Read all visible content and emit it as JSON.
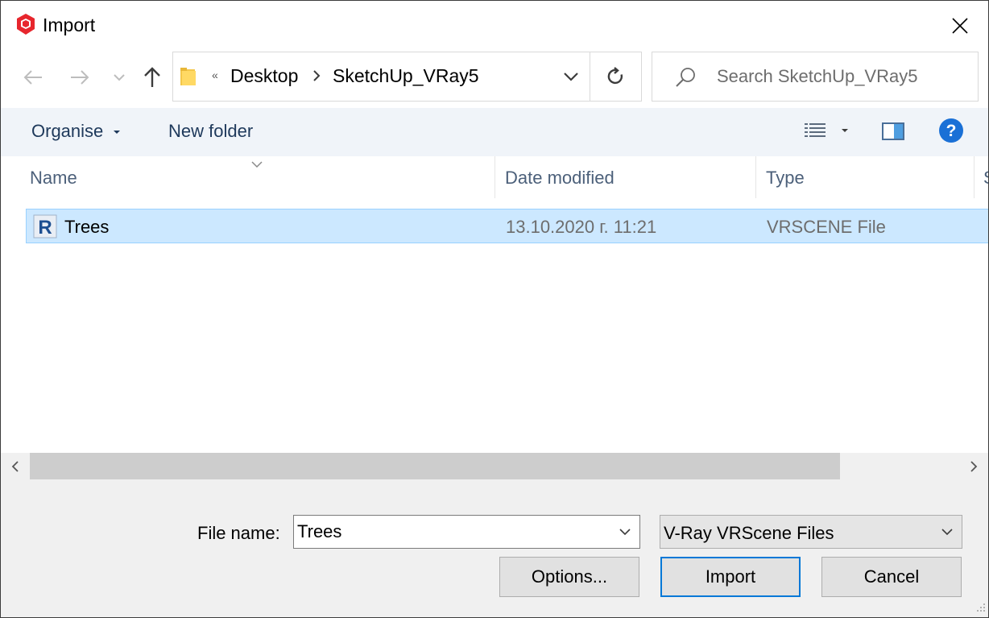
{
  "window": {
    "title": "Import",
    "app_icon": "sketchup-logo-icon"
  },
  "nav": {
    "back_icon": "back-arrow-icon",
    "forward_icon": "forward-arrow-icon",
    "recent_icon": "chevron-down-icon",
    "up_icon": "up-arrow-icon"
  },
  "address": {
    "overflow": "«",
    "crumbs": [
      "Desktop",
      "SketchUp_VRay5"
    ]
  },
  "search": {
    "placeholder": "Search SketchUp_VRay5"
  },
  "toolbar": {
    "organise": "Organise",
    "new_folder": "New folder"
  },
  "columns": {
    "name": "Name",
    "date": "Date modified",
    "type": "Type",
    "size_partial": "S"
  },
  "files": [
    {
      "name": "Trees",
      "date": "13.10.2020 г. 11:21",
      "type": "VRSCENE File",
      "icon": "vrscene-file-icon"
    }
  ],
  "bottom": {
    "file_name_label": "File name:",
    "file_name_value": "Trees",
    "file_type": "V-Ray VRScene Files",
    "options_label": "Options...",
    "import_label": "Import",
    "cancel_label": "Cancel"
  },
  "colors": {
    "selection": "#cce8ff",
    "selection_border": "#99d1ff",
    "toolbar_bg": "#f0f4f9",
    "accent": "#0078d7",
    "help_blue": "#1a70d6"
  }
}
